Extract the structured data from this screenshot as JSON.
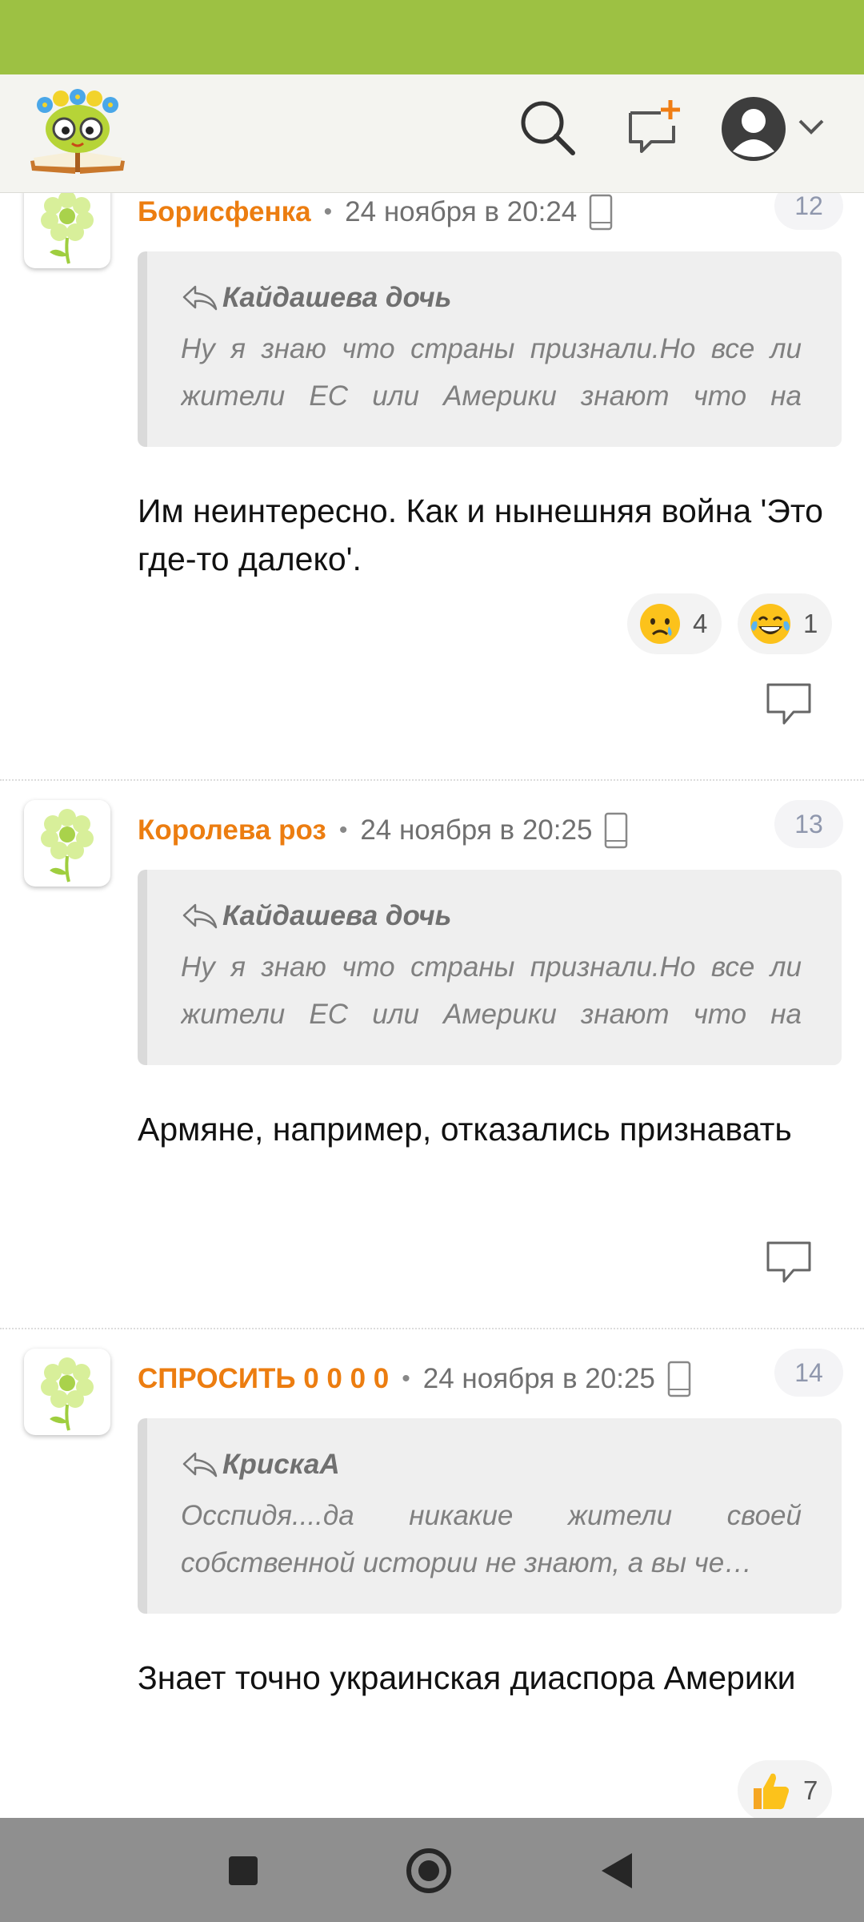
{
  "colors": {
    "status_bar": "#9dc143",
    "author": "#ec7d10",
    "header_bg": "#f4f4f0"
  },
  "header": {
    "logo": "smiling-book-mascot-logo",
    "icons": [
      "search-icon",
      "new-post-icon",
      "profile-avatar-icon",
      "chevron-down-icon"
    ]
  },
  "comments": [
    {
      "author": "Борисфенка",
      "date": "24 ноября в 20:24",
      "number": "12",
      "quote": {
        "author": "Кайдашева дочь",
        "text": "Ну я знаю что страны признали.Но все ли жители ЕС или Америки знают что на само…"
      },
      "text": "Им неинтересно. Как и нынешняя война 'Это где-то далеко'.",
      "reactions": [
        {
          "icon": "crying-face-emoji",
          "count": "4"
        },
        {
          "icon": "tears-of-joy-emoji",
          "count": "1"
        }
      ]
    },
    {
      "author": "Королева роз",
      "date": "24 ноября в 20:25",
      "number": "13",
      "quote": {
        "author": "Кайдашева дочь",
        "text": "Ну я знаю что страны признали.Но все ли жители ЕС или Америки знают что на само…"
      },
      "text": "Армяне, например, отказались признавать",
      "reactions": []
    },
    {
      "author": "СПРОСИТЬ 0 0 0 0",
      "date": "24 ноября в 20:25",
      "number": "14",
      "quote": {
        "author": "КрискаА",
        "text": "Осспидя....да никакие жители своей собственной истории не знают, а вы че…"
      },
      "text": "Знает точно украинская диаспора Америки",
      "reactions": [
        {
          "icon": "thumbs-up-emoji",
          "count": "7"
        }
      ]
    }
  ],
  "nav": {
    "buttons": [
      "recents-square-icon",
      "home-circle-icon",
      "back-triangle-icon"
    ]
  }
}
